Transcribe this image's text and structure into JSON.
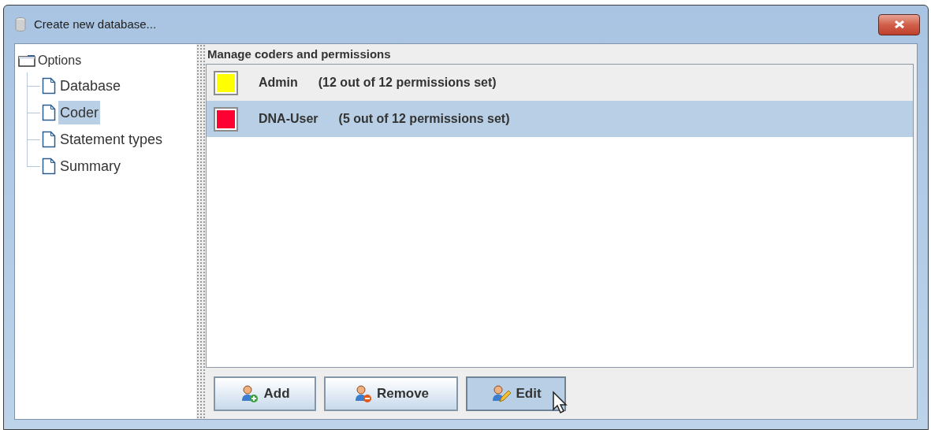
{
  "window": {
    "title": "Create new database..."
  },
  "tree": {
    "label": "Options",
    "children": [
      {
        "label": "Database",
        "selected": false
      },
      {
        "label": "Coder",
        "selected": true
      },
      {
        "label": "Statement types",
        "selected": false
      },
      {
        "label": "Summary",
        "selected": false
      }
    ]
  },
  "panel": {
    "title": "Manage coders and permissions"
  },
  "coders": [
    {
      "name": "Admin",
      "permissions": "(12 out of 12 permissions set)",
      "color": "#ffff00",
      "selected": false
    },
    {
      "name": "DNA-User",
      "permissions": "(5 out of 12 permissions set)",
      "color": "#ff0033",
      "selected": true
    }
  ],
  "buttons": [
    {
      "label": "Add",
      "kind": "add",
      "active": false
    },
    {
      "label": "Remove",
      "kind": "remove",
      "active": false
    },
    {
      "label": "Edit",
      "kind": "edit",
      "active": true
    }
  ]
}
